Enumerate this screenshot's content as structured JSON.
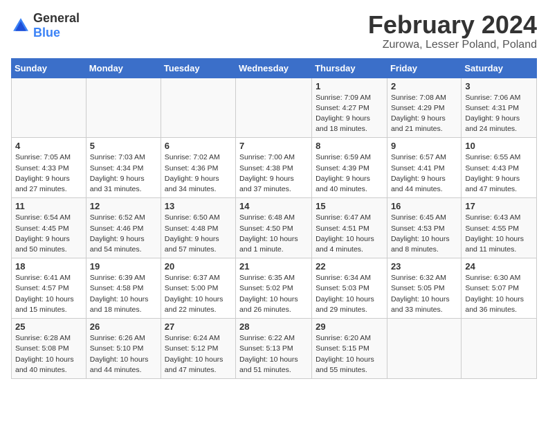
{
  "logo": {
    "general": "General",
    "blue": "Blue"
  },
  "title": "February 2024",
  "subtitle": "Zurowa, Lesser Poland, Poland",
  "headers": [
    "Sunday",
    "Monday",
    "Tuesday",
    "Wednesday",
    "Thursday",
    "Friday",
    "Saturday"
  ],
  "weeks": [
    [
      {
        "day": "",
        "info": ""
      },
      {
        "day": "",
        "info": ""
      },
      {
        "day": "",
        "info": ""
      },
      {
        "day": "",
        "info": ""
      },
      {
        "day": "1",
        "info": "Sunrise: 7:09 AM\nSunset: 4:27 PM\nDaylight: 9 hours\nand 18 minutes."
      },
      {
        "day": "2",
        "info": "Sunrise: 7:08 AM\nSunset: 4:29 PM\nDaylight: 9 hours\nand 21 minutes."
      },
      {
        "day": "3",
        "info": "Sunrise: 7:06 AM\nSunset: 4:31 PM\nDaylight: 9 hours\nand 24 minutes."
      }
    ],
    [
      {
        "day": "4",
        "info": "Sunrise: 7:05 AM\nSunset: 4:33 PM\nDaylight: 9 hours\nand 27 minutes."
      },
      {
        "day": "5",
        "info": "Sunrise: 7:03 AM\nSunset: 4:34 PM\nDaylight: 9 hours\nand 31 minutes."
      },
      {
        "day": "6",
        "info": "Sunrise: 7:02 AM\nSunset: 4:36 PM\nDaylight: 9 hours\nand 34 minutes."
      },
      {
        "day": "7",
        "info": "Sunrise: 7:00 AM\nSunset: 4:38 PM\nDaylight: 9 hours\nand 37 minutes."
      },
      {
        "day": "8",
        "info": "Sunrise: 6:59 AM\nSunset: 4:39 PM\nDaylight: 9 hours\nand 40 minutes."
      },
      {
        "day": "9",
        "info": "Sunrise: 6:57 AM\nSunset: 4:41 PM\nDaylight: 9 hours\nand 44 minutes."
      },
      {
        "day": "10",
        "info": "Sunrise: 6:55 AM\nSunset: 4:43 PM\nDaylight: 9 hours\nand 47 minutes."
      }
    ],
    [
      {
        "day": "11",
        "info": "Sunrise: 6:54 AM\nSunset: 4:45 PM\nDaylight: 9 hours\nand 50 minutes."
      },
      {
        "day": "12",
        "info": "Sunrise: 6:52 AM\nSunset: 4:46 PM\nDaylight: 9 hours\nand 54 minutes."
      },
      {
        "day": "13",
        "info": "Sunrise: 6:50 AM\nSunset: 4:48 PM\nDaylight: 9 hours\nand 57 minutes."
      },
      {
        "day": "14",
        "info": "Sunrise: 6:48 AM\nSunset: 4:50 PM\nDaylight: 10 hours\nand 1 minute."
      },
      {
        "day": "15",
        "info": "Sunrise: 6:47 AM\nSunset: 4:51 PM\nDaylight: 10 hours\nand 4 minutes."
      },
      {
        "day": "16",
        "info": "Sunrise: 6:45 AM\nSunset: 4:53 PM\nDaylight: 10 hours\nand 8 minutes."
      },
      {
        "day": "17",
        "info": "Sunrise: 6:43 AM\nSunset: 4:55 PM\nDaylight: 10 hours\nand 11 minutes."
      }
    ],
    [
      {
        "day": "18",
        "info": "Sunrise: 6:41 AM\nSunset: 4:57 PM\nDaylight: 10 hours\nand 15 minutes."
      },
      {
        "day": "19",
        "info": "Sunrise: 6:39 AM\nSunset: 4:58 PM\nDaylight: 10 hours\nand 18 minutes."
      },
      {
        "day": "20",
        "info": "Sunrise: 6:37 AM\nSunset: 5:00 PM\nDaylight: 10 hours\nand 22 minutes."
      },
      {
        "day": "21",
        "info": "Sunrise: 6:35 AM\nSunset: 5:02 PM\nDaylight: 10 hours\nand 26 minutes."
      },
      {
        "day": "22",
        "info": "Sunrise: 6:34 AM\nSunset: 5:03 PM\nDaylight: 10 hours\nand 29 minutes."
      },
      {
        "day": "23",
        "info": "Sunrise: 6:32 AM\nSunset: 5:05 PM\nDaylight: 10 hours\nand 33 minutes."
      },
      {
        "day": "24",
        "info": "Sunrise: 6:30 AM\nSunset: 5:07 PM\nDaylight: 10 hours\nand 36 minutes."
      }
    ],
    [
      {
        "day": "25",
        "info": "Sunrise: 6:28 AM\nSunset: 5:08 PM\nDaylight: 10 hours\nand 40 minutes."
      },
      {
        "day": "26",
        "info": "Sunrise: 6:26 AM\nSunset: 5:10 PM\nDaylight: 10 hours\nand 44 minutes."
      },
      {
        "day": "27",
        "info": "Sunrise: 6:24 AM\nSunset: 5:12 PM\nDaylight: 10 hours\nand 47 minutes."
      },
      {
        "day": "28",
        "info": "Sunrise: 6:22 AM\nSunset: 5:13 PM\nDaylight: 10 hours\nand 51 minutes."
      },
      {
        "day": "29",
        "info": "Sunrise: 6:20 AM\nSunset: 5:15 PM\nDaylight: 10 hours\nand 55 minutes."
      },
      {
        "day": "",
        "info": ""
      },
      {
        "day": "",
        "info": ""
      }
    ]
  ]
}
